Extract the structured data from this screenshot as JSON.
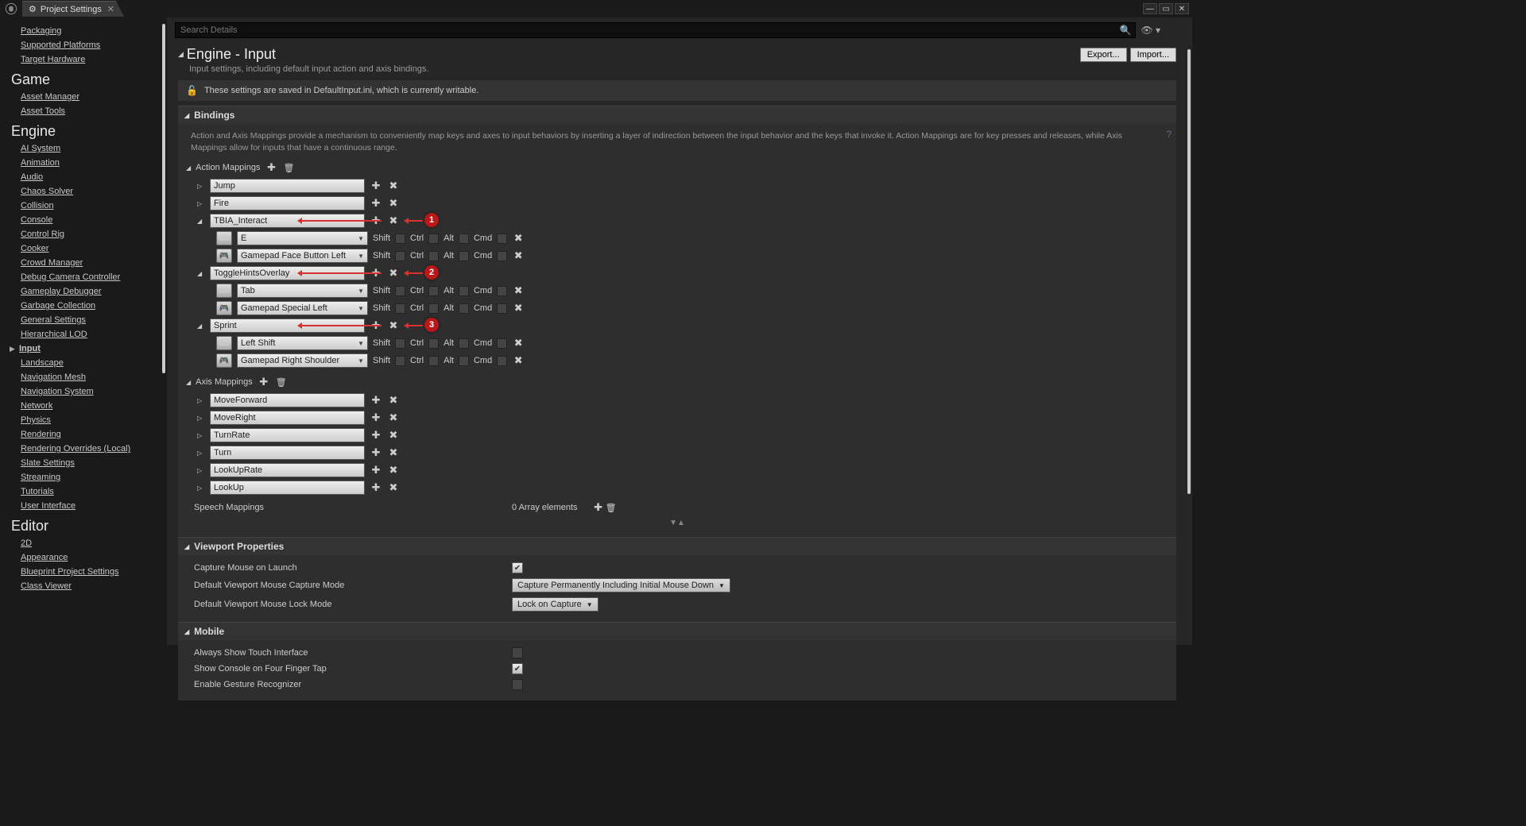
{
  "tab_title": "Project Settings",
  "search_placeholder": "Search Details",
  "header": {
    "title": "Engine - Input",
    "desc": "Input settings, including default input action and axis bindings.",
    "export": "Export...",
    "import": "Import..."
  },
  "save_banner": "These settings are saved in DefaultInput.ini, which is currently writable.",
  "sidebar": {
    "top": [
      "Packaging",
      "Supported Platforms",
      "Target Hardware"
    ],
    "game_h": "Game",
    "game": [
      "Asset Manager",
      "Asset Tools"
    ],
    "engine_h": "Engine",
    "engine": [
      "AI System",
      "Animation",
      "Audio",
      "Chaos Solver",
      "Collision",
      "Console",
      "Control Rig",
      "Cooker",
      "Crowd Manager",
      "Debug Camera Controller",
      "Gameplay Debugger",
      "Garbage Collection",
      "General Settings",
      "Hierarchical LOD",
      "Input",
      "Landscape",
      "Navigation Mesh",
      "Navigation System",
      "Network",
      "Physics",
      "Rendering",
      "Rendering Overrides (Local)",
      "Slate Settings",
      "Streaming",
      "Tutorials",
      "User Interface"
    ],
    "editor_h": "Editor",
    "editor": [
      "2D",
      "Appearance",
      "Blueprint Project Settings",
      "Class Viewer"
    ]
  },
  "bindings": {
    "title": "Bindings",
    "desc": "Action and Axis Mappings provide a mechanism to conveniently map keys and axes to input behaviors by inserting a layer of indirection between the input behavior and the keys that invoke it. Action Mappings are for key presses and releases, while Axis Mappings allow for inputs that have a continuous range.",
    "action_label": "Action Mappings",
    "axis_label": "Axis Mappings",
    "mods": {
      "shift": "Shift",
      "ctrl": "Ctrl",
      "alt": "Alt",
      "cmd": "Cmd"
    },
    "actions": [
      {
        "name": "Jump",
        "expanded": false,
        "keys": []
      },
      {
        "name": "Fire",
        "expanded": false,
        "keys": []
      },
      {
        "name": "TBIA_Interact",
        "expanded": true,
        "annot": 1,
        "keys": [
          {
            "key": "E",
            "iconType": "kb"
          },
          {
            "key": "Gamepad Face Button Left",
            "iconType": "pad"
          }
        ]
      },
      {
        "name": "ToggleHintsOverlay",
        "expanded": true,
        "annot": 2,
        "keys": [
          {
            "key": "Tab",
            "iconType": "kb"
          },
          {
            "key": "Gamepad Special Left",
            "iconType": "pad"
          }
        ]
      },
      {
        "name": "Sprint",
        "expanded": true,
        "annot": 3,
        "keys": [
          {
            "key": "Left Shift",
            "iconType": "kb"
          },
          {
            "key": "Gamepad Right Shoulder",
            "iconType": "pad"
          }
        ]
      }
    ],
    "axes": [
      {
        "name": "MoveForward"
      },
      {
        "name": "MoveRight"
      },
      {
        "name": "TurnRate"
      },
      {
        "name": "Turn"
      },
      {
        "name": "LookUpRate"
      },
      {
        "name": "LookUp"
      }
    ],
    "speech_label": "Speech Mappings",
    "speech_elems": "0 Array elements"
  },
  "viewport": {
    "title": "Viewport Properties",
    "rows": [
      {
        "label": "Capture Mouse on Launch",
        "type": "check",
        "checked": true
      },
      {
        "label": "Default Viewport Mouse Capture Mode",
        "type": "select",
        "value": "Capture Permanently Including Initial Mouse Down"
      },
      {
        "label": "Default Viewport Mouse Lock Mode",
        "type": "select",
        "value": "Lock on Capture"
      }
    ]
  },
  "mobile": {
    "title": "Mobile",
    "rows": [
      {
        "label": "Always Show Touch Interface",
        "type": "check",
        "checked": false
      },
      {
        "label": "Show Console on Four Finger Tap",
        "type": "check",
        "checked": true
      },
      {
        "label": "Enable Gesture Recognizer",
        "type": "check",
        "checked": false
      }
    ]
  }
}
